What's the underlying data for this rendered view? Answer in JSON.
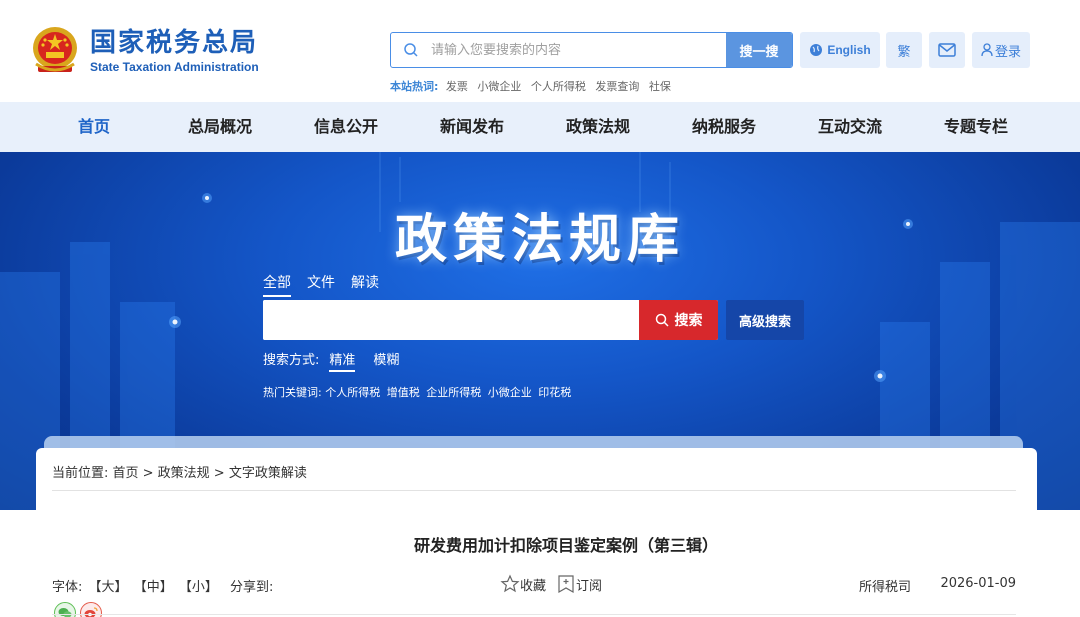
{
  "header": {
    "logo_cn": "国家税务总局",
    "logo_en": "State Taxation Administration",
    "search": {
      "placeholder": "请输入您要搜索的内容",
      "button": "搜一搜"
    },
    "hot": {
      "label": "本站热词:",
      "keywords": [
        "发票",
        "小微企业",
        "个人所得税",
        "发票查询",
        "社保"
      ]
    },
    "english_label": "English",
    "traditional_label": "繁",
    "login_label": "登录"
  },
  "nav": {
    "items": [
      "首页",
      "总局概况",
      "信息公开",
      "新闻发布",
      "政策法规",
      "纳税服务",
      "互动交流",
      "专题专栏"
    ]
  },
  "banner": {
    "title": "政策法规库",
    "tabs": [
      "全部",
      "文件",
      "解读"
    ],
    "search_button": "搜索",
    "advanced_button": "高级搜索",
    "mode_label": "搜索方式:",
    "modes": [
      "精准",
      "模糊"
    ],
    "hot_label": "热门关键词:",
    "hot_keywords": [
      "个人所得税",
      "增值税",
      "企业所得税",
      "小微企业",
      "印花税"
    ]
  },
  "article": {
    "breadcrumb": "当前位置: 首页 > 政策法规 > 文字政策解读",
    "title": "研发费用加计扣除项目鉴定案例（第三辑）",
    "font_label": "字体:",
    "font_large": "【大】",
    "font_mid": "【中】",
    "font_small": "【小】",
    "share_label": "分享到:",
    "favorite_label": "收藏",
    "subscribe_label": "订阅",
    "source": "所得税司",
    "date": "2026-01-09"
  },
  "colors": {
    "primary": "#1e5fb8",
    "nav_bg": "#e8f0fb",
    "search_red": "#d7282c",
    "advanced_blue": "#1546a8"
  }
}
